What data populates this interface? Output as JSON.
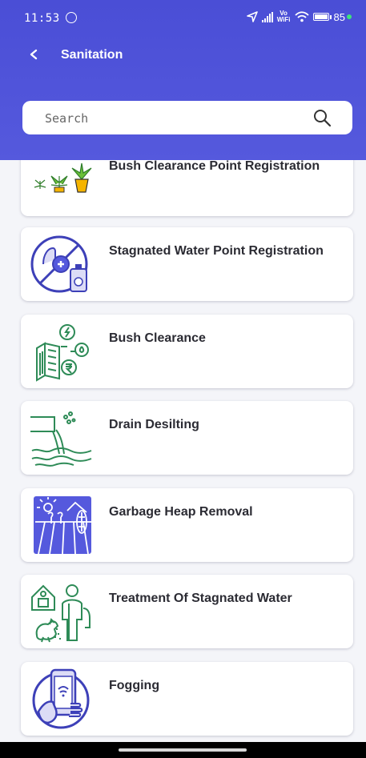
{
  "status_bar": {
    "time": "11:53",
    "volte_top": "Vo",
    "volte_bottom": "WiFi",
    "battery": "85"
  },
  "header": {
    "title": "Sanitation",
    "back_icon": "chevron-left-icon"
  },
  "search": {
    "placeholder": "Search",
    "value": "",
    "icon": "search-icon"
  },
  "list": {
    "items": [
      {
        "label": "Bush Clearance Point Registration",
        "icon": "plants-icon"
      },
      {
        "label": "Stagnated Water Point Registration",
        "icon": "no-water-bottle-icon"
      },
      {
        "label": "Bush Clearance",
        "icon": "document-coins-icon"
      },
      {
        "label": "Drain Desilting",
        "icon": "drain-outflow-icon"
      },
      {
        "label": "Garbage Heap Removal",
        "icon": "farm-field-icon"
      },
      {
        "label": "Treatment Of Stagnated Water",
        "icon": "farmer-rooster-icon"
      },
      {
        "label": "Fogging",
        "icon": "phone-in-hand-icon"
      }
    ]
  },
  "colors": {
    "header": "#5559dd",
    "icon_stroke": "#3d40b8",
    "icon_accent": "#8fd14f",
    "icon_yellow": "#f5b400"
  }
}
